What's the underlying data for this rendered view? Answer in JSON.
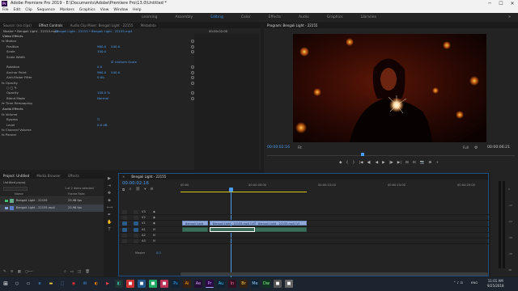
{
  "window": {
    "title": "Adobe Premiere Pro 2019 - E:\\Documents\\Adobe\\Premiere Pro\\13.0\\Untitled *",
    "app_icon": "Pr",
    "min": "─",
    "max": "☐",
    "close": "✕"
  },
  "menu": [
    "File",
    "Edit",
    "Clip",
    "Sequence",
    "Markers",
    "Graphics",
    "View",
    "Window",
    "Help"
  ],
  "workspaces": [
    "Learning",
    "Assembly",
    "Editing",
    "Color",
    "Effects",
    "Audio",
    "Graphics",
    "Libraries"
  ],
  "workspaces_more": "»",
  "effect_panel": {
    "tabs": [
      "Source: (no clips)",
      "Effect Controls",
      "Audio Clip Mixer: Bengali Light - 22155",
      "Metadata"
    ],
    "breadcrumb": "Master * Bengali Light - 22155.mp4",
    "breadcrumb2": "Bengali Light - 22155 * Bengali Light - 22155.mp4",
    "timecode": "00:00:02:00",
    "mini_clip": "Bengali Light - 22155.mp4",
    "video_effects": "Video Effects",
    "audio_effects": "Audio Effects",
    "rows": [
      {
        "label": "fx  Motion",
        "ind": 2,
        "v": "",
        "v2": ""
      },
      {
        "label": "Position",
        "ind": 8,
        "v": "960.0",
        "v2": "540.0"
      },
      {
        "label": "Scale",
        "ind": 8,
        "v": "100.0",
        "v2": ""
      },
      {
        "label": "Scale Width",
        "ind": 8,
        "v": "",
        "v2": ""
      },
      {
        "label": "",
        "ind": 8,
        "v": "",
        "v2": "☑ Uniform Scale"
      },
      {
        "label": "Rotation",
        "ind": 8,
        "v": "0.0",
        "v2": ""
      },
      {
        "label": "Anchor Point",
        "ind": 8,
        "v": "960.0",
        "v2": "540.0"
      },
      {
        "label": "Anti-flicker Filter",
        "ind": 8,
        "v": "0.00",
        "v2": ""
      },
      {
        "label": "fx  Opacity",
        "ind": 2,
        "v": "",
        "v2": ""
      },
      {
        "label": "○ □ ✎",
        "ind": 8,
        "v": "",
        "v2": ""
      },
      {
        "label": "Opacity",
        "ind": 8,
        "v": "100.0 %",
        "v2": ""
      },
      {
        "label": "Blend Mode",
        "ind": 8,
        "v": "Normal",
        "v2": ""
      },
      {
        "label": "fx  Time Remapping",
        "ind": 2,
        "v": "",
        "v2": ""
      }
    ],
    "audio_rows": [
      {
        "label": "fx  Volume",
        "ind": 2,
        "v": ""
      },
      {
        "label": "Bypass",
        "ind": 8,
        "v": "☐"
      },
      {
        "label": "Level",
        "ind": 8,
        "v": "0.0 dB"
      },
      {
        "label": "fx  Channel Volume",
        "ind": 2,
        "v": ""
      },
      {
        "label": "fx  Panner",
        "ind": 2,
        "v": ""
      }
    ]
  },
  "program": {
    "title": "Program: Bengali Light - 22155",
    "timecode": "00:00:02:16",
    "fit": "Fit",
    "quality": "Full",
    "duration": "00:00:06:21",
    "controls": [
      "◆",
      "{",
      "}",
      "|◀",
      "◀|",
      "◀",
      "▶",
      "|▶",
      "▶|",
      "⊟",
      "⊡",
      "📷",
      "⊞",
      "+"
    ]
  },
  "project": {
    "tabs": [
      "Project: Untitled",
      "Media Browser",
      "Effects"
    ],
    "name": "Untitled.prproj",
    "count": "1 of 2 items selected",
    "col_name": "Name",
    "col_fr": "Frame Rate",
    "items": [
      {
        "name": "Bengali Light - 22155",
        "fr": "23.98 fps"
      },
      {
        "name": "Bengali Light - 22155.mp4",
        "fr": "23.98 fps"
      }
    ]
  },
  "timeline": {
    "tab": "Bengali Light - 22155",
    "timecode": "00:00:02:16",
    "ruler": [
      "00:00",
      "00:00:05:00",
      "00:00:10:00",
      "00:00:15:00",
      "00:00:20:00"
    ],
    "tracks": [
      "V3",
      "V2",
      "V1",
      "A1",
      "A2",
      "A3"
    ],
    "master": "Master",
    "master_val": "0.0",
    "clips": [
      "Bengali Light",
      "Bengali Light - 22155.mp4 [V]",
      "Bengali Light - 22155.mp4 [V]"
    ]
  },
  "tools": [
    "▶",
    "⇥",
    "✥",
    "◈",
    "⟷",
    "✒",
    "✋",
    "T"
  ],
  "meter_labels": [
    "0",
    "-12",
    "-24",
    "-36",
    "-48",
    "dB"
  ],
  "taskbar": {
    "time": "11:01 AM",
    "date": "9/25/2018",
    "lang": "ENG"
  }
}
